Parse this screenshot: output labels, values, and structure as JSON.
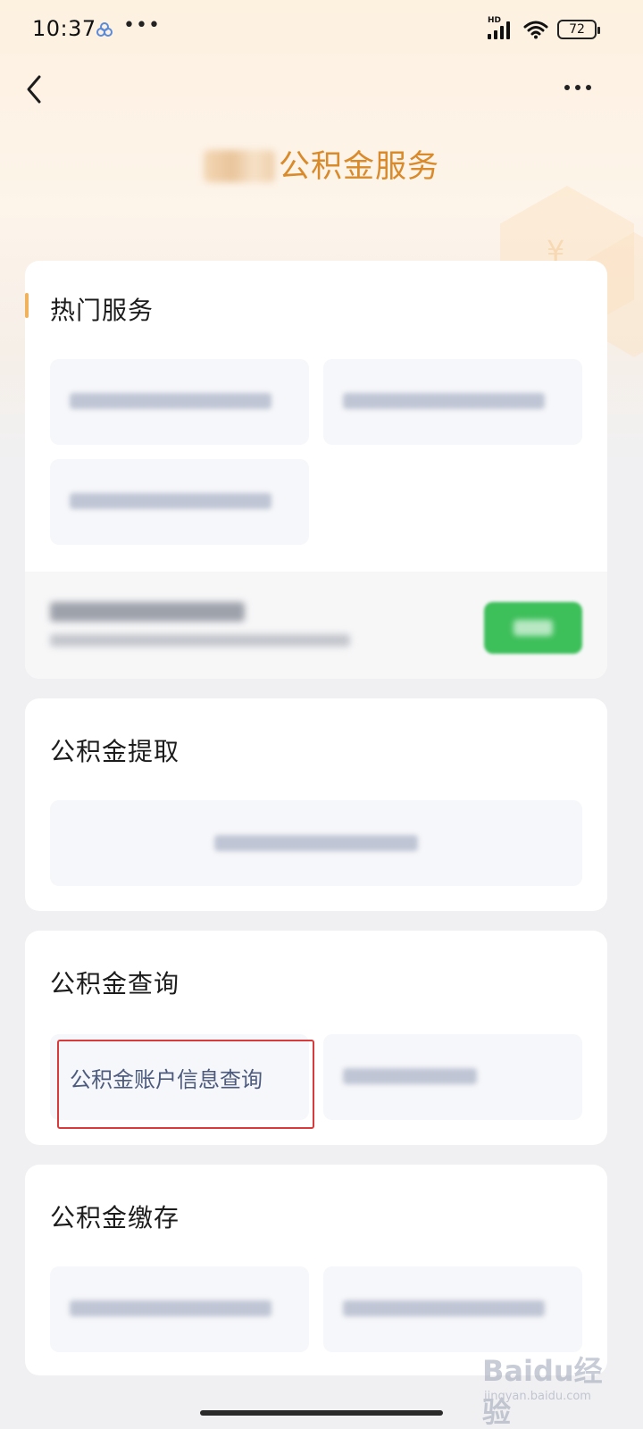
{
  "status_bar": {
    "time": "10:37",
    "more": "•••",
    "signal_tag": "HD",
    "battery": "72"
  },
  "nav": {
    "back_icon": "chevron-left-icon",
    "menu_icon": "more-dots-icon"
  },
  "page": {
    "title": "公积金服务"
  },
  "sections": {
    "hot": {
      "title": "热门服务",
      "marker_color": "#f0b25c"
    },
    "withdraw": {
      "title": "公积金提取"
    },
    "query": {
      "title": "公积金查询",
      "items": [
        {
          "label": "公积金账户信息查询",
          "highlighted": true
        }
      ]
    },
    "deposit": {
      "title": "公积金缴存"
    }
  },
  "colors": {
    "title": "#d98a2b",
    "tile_text": "#4c5a7e",
    "promo_button": "#3dbf5a",
    "highlight": "#d83b3b"
  },
  "watermark": {
    "logo": "Baidu经验",
    "sub": "jingyan.baidu.com"
  }
}
